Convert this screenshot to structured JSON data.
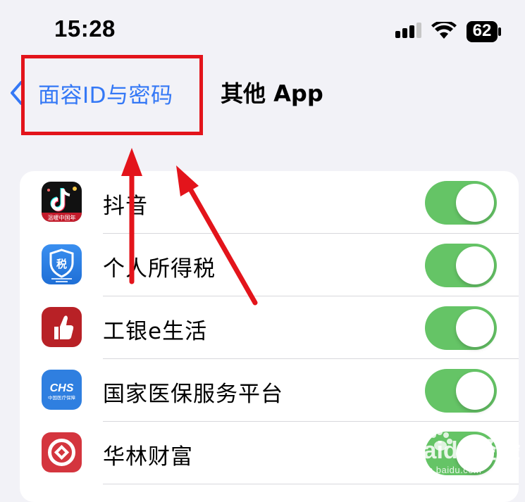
{
  "status_bar": {
    "time": "15:28",
    "battery": "62"
  },
  "nav": {
    "back_label": "面容ID与密码",
    "title": "其他 App"
  },
  "apps": [
    {
      "name": "抖音",
      "enabled": true,
      "icon": "douyin-icon",
      "icon_caption": "温暖中国年"
    },
    {
      "name": "个人所得税",
      "enabled": true,
      "icon": "tax-shield-icon",
      "icon_badge": "税"
    },
    {
      "name": "工银e生活",
      "enabled": true,
      "icon": "thumbs-up-icon"
    },
    {
      "name": "国家医保服务平台",
      "enabled": true,
      "icon": "chs-icon",
      "icon_badge": "CHS",
      "icon_caption": "中国医疗保障"
    },
    {
      "name": "华林财富",
      "enabled": true,
      "icon": "coin-icon"
    }
  ],
  "watermark": {
    "brand": "Baidu经验",
    "url": "jingyan.baidu.com"
  },
  "colors": {
    "accent": "#3478f6",
    "toggle_on": "#65c466",
    "annotation": "#e3141b",
    "background": "#f2f2f7"
  }
}
